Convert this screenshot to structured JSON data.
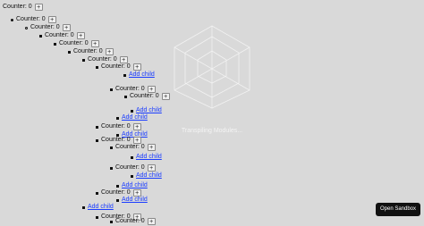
{
  "tree": {
    "rows": [
      {
        "kind": "counter",
        "label": "Counter: 0",
        "btn": "+",
        "bullet": "none"
      },
      {
        "kind": "counter",
        "label": "Counter: 0",
        "btn": "+",
        "bullet": "disc"
      },
      {
        "kind": "counter",
        "label": "Counter: 0",
        "btn": "+",
        "bullet": "circle"
      },
      {
        "kind": "counter",
        "label": "Counter: 0",
        "btn": "+",
        "bullet": "square"
      },
      {
        "kind": "counter",
        "label": "Counter: 0",
        "btn": "+",
        "bullet": "square"
      },
      {
        "kind": "counter",
        "label": "Counter: 0",
        "btn": "+",
        "bullet": "square"
      },
      {
        "kind": "counter",
        "label": "Counter: 0",
        "btn": "+",
        "bullet": "square"
      },
      {
        "kind": "counter",
        "label": "Counter: 0",
        "btn": "+",
        "bullet": "square"
      },
      {
        "kind": "link",
        "label": "Add child",
        "bullet": "square"
      },
      {
        "kind": "counter",
        "label": "Counter: 0",
        "btn": "+",
        "bullet": "square"
      },
      {
        "kind": "counter",
        "label": "Counter: 0",
        "btn": "+",
        "bullet": "square"
      },
      {
        "kind": "link",
        "label": "Add child",
        "bullet": "square"
      },
      {
        "kind": "link",
        "label": "Add child",
        "bullet": "square"
      },
      {
        "kind": "counter",
        "label": "Counter: 0",
        "btn": "+",
        "bullet": "square"
      },
      {
        "kind": "link",
        "label": "Add child",
        "bullet": "square"
      },
      {
        "kind": "counter",
        "label": "Counter: 0",
        "btn": "+",
        "bullet": "square"
      },
      {
        "kind": "counter",
        "label": "Counter: 0",
        "btn": "+",
        "bullet": "square"
      },
      {
        "kind": "link",
        "label": "Add child",
        "bullet": "square"
      },
      {
        "kind": "counter",
        "label": "Counter: 0",
        "btn": "+",
        "bullet": "square"
      },
      {
        "kind": "link",
        "label": "Add child",
        "bullet": "square"
      },
      {
        "kind": "link",
        "label": "Add child",
        "bullet": "square"
      },
      {
        "kind": "counter",
        "label": "Counter: 0",
        "btn": "+",
        "bullet": "square"
      },
      {
        "kind": "link",
        "label": "Add child",
        "bullet": "square"
      },
      {
        "kind": "link",
        "label": "Add child",
        "bullet": "square"
      },
      {
        "kind": "counter",
        "label": "Counter: 0",
        "btn": "+",
        "bullet": "square"
      },
      {
        "kind": "counter",
        "label": "Counter: 0",
        "btn": "+",
        "bullet": "square"
      }
    ]
  },
  "overlay": {
    "status": "Transpiling Modules...",
    "logo_icon": "codesandbox-cube-icon"
  },
  "footer": {
    "open_sandbox_label": "Open Sandbox"
  },
  "colors": {
    "background": "#d9d9d9",
    "link": "#1a3cff",
    "button_bg": "#111111"
  }
}
